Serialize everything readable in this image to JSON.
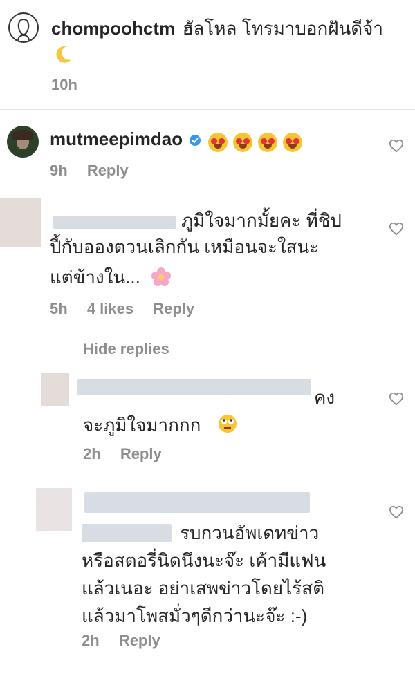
{
  "comments": [
    {
      "username": "chompoohctm",
      "text": "ฮัลโหล โทรมาบอกฝันดีจ้า",
      "time": "10h",
      "icons": [
        "crescent-moon-icon"
      ]
    },
    {
      "username": "mutmeepimdao",
      "verified_icon": "verified-badge-icon",
      "emoji": [
        "heart-eyes-emoji",
        "heart-eyes-emoji",
        "heart-eyes-emoji",
        "heart-eyes-emoji"
      ],
      "time": "9h",
      "reply_label": "Reply"
    },
    {
      "text_lines": [
        "ภูมิใจมากมั้ยคะ ที่ชิป",
        "ปี้กับอองตวนเลิกกัน เหมือนจะใสนะ",
        "แต่ข้างใน..."
      ],
      "icons": [
        "pink-flower-icon"
      ],
      "time": "5h",
      "likes": "4 likes",
      "reply_label": "Reply"
    }
  ],
  "hide_replies_label": "Hide replies",
  "replies": [
    {
      "text_lines": [
        "คง",
        "จะภูมิใจมากกก"
      ],
      "icons": [
        "rolling-eyes-emoji"
      ],
      "time": "2h",
      "reply_label": "Reply"
    },
    {
      "text_lines": [
        "รบกวนอัพเดทข่าว",
        "หรือสตอรี่นิดนึงนะจ๊ะ เค้ามีแฟน",
        "แล้วเนอะ อย่าเสพข่าวโดยไร้สติ",
        "แล้วมาโพสมั่วๆดีกว่านะจ๊ะ :-)"
      ],
      "time": "2h",
      "reply_label": "Reply"
    }
  ],
  "like_icon": "heart-outline-icon"
}
